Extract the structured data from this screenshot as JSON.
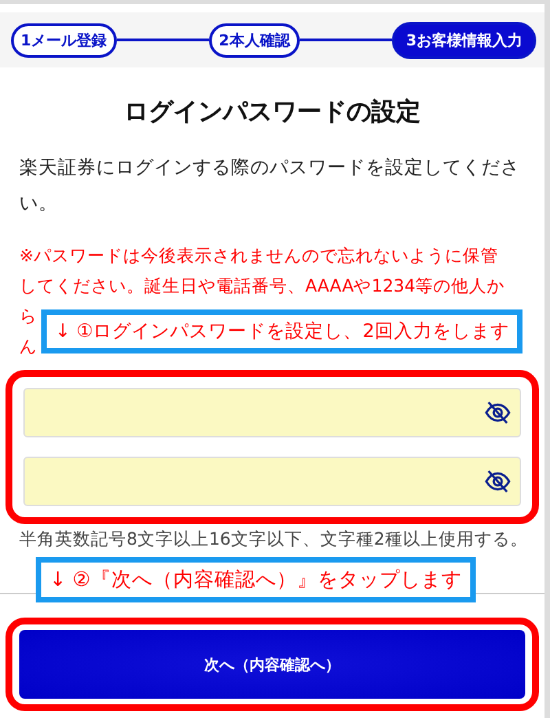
{
  "steps": [
    {
      "label": "1メール登録",
      "selected": false
    },
    {
      "label": "2本人確認",
      "selected": false
    },
    {
      "label": "3お客様情報入力",
      "selected": true
    }
  ],
  "title": "ログインパスワードの設定",
  "intro": "楽天証券にログインする際のパスワードを設定してください。",
  "warning_lines": [
    "※パスワードは今後表示されませんので忘れないように保管",
    "してください。誕生日や電話番号、AAAAや1234等の他人か",
    "ら",
    "ん"
  ],
  "callouts": [
    {
      "text": "↓ ①ログインパスワードを設定し、2回入力をします"
    },
    {
      "text": "↓ ②『次へ（内容確認へ）』をタップします"
    }
  ],
  "password_fields": [
    {
      "masked": true
    },
    {
      "masked": true
    }
  ],
  "hint": "半角英数記号8文字以上16文字以下、文字種2種以上使用する。",
  "next_button": "次へ（内容確認へ）"
}
